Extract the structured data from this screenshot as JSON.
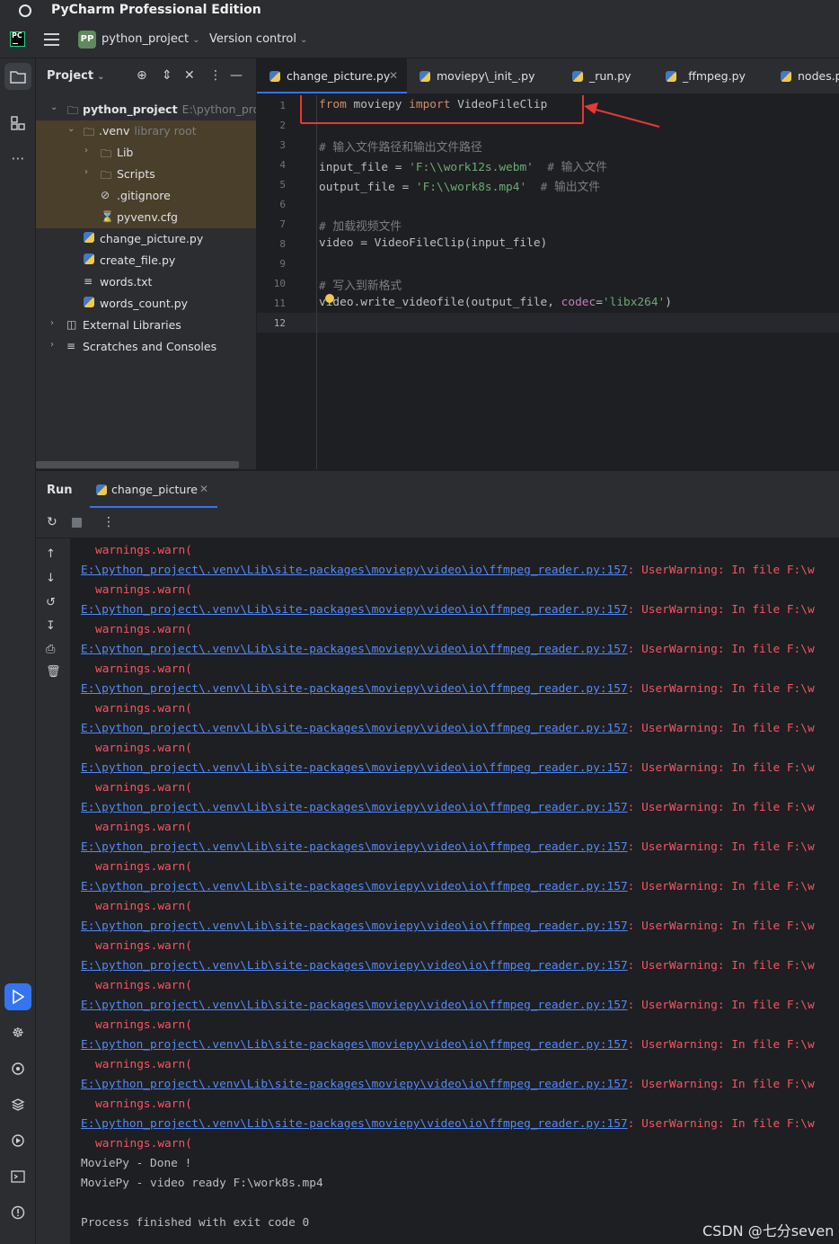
{
  "titlebar": {
    "title": "PyCharm Professional Edition"
  },
  "toolbar": {
    "project_badge": "PP",
    "project_name": "python_project",
    "vcs": "Version control"
  },
  "project_panel": {
    "title": "Project",
    "tree": [
      {
        "name": "python_project",
        "hint": "E:\\python_project"
      },
      {
        "name": ".venv",
        "hint": "library root"
      },
      {
        "name": "Lib"
      },
      {
        "name": "Scripts"
      },
      {
        "name": ".gitignore"
      },
      {
        "name": "pyvenv.cfg"
      },
      {
        "name": "change_picture.py"
      },
      {
        "name": "create_file.py"
      },
      {
        "name": "words.txt"
      },
      {
        "name": "words_count.py"
      },
      {
        "name": "External Libraries"
      },
      {
        "name": "Scratches and Consoles"
      }
    ]
  },
  "tabs": [
    {
      "label": "change_picture.py"
    },
    {
      "label": "moviepy\\_init_.py"
    },
    {
      "label": "_run.py"
    },
    {
      "label": "_ffmpeg.py"
    },
    {
      "label": "nodes.p"
    }
  ],
  "editor": {
    "line_numbers": [
      "1",
      "2",
      "3",
      "4",
      "5",
      "6",
      "7",
      "8",
      "9",
      "10",
      "11",
      "12"
    ],
    "code": {
      "l1_from": "from",
      "l1_mod": " moviepy ",
      "l1_import": "import",
      "l1_name": " VideoFileClip",
      "l3": "# 输入文件路径和输出文件路径",
      "l4_a": "input_file = ",
      "l4_s": "'F:\\\\work12s.webm'",
      "l4_c": "  # 输入文件",
      "l5_a": "output_file = ",
      "l5_s": "'F:\\\\work8s.mp4'",
      "l5_c": "  # 输出文件",
      "l7": "# 加载视频文件",
      "l8": "video = VideoFileClip(input_file)",
      "l10": "# 写入到新格式",
      "l11_a": "video.write_videofile(output_file, ",
      "l11_p": "codec",
      "l11_b": "=",
      "l11_s": "'libx264'",
      "l11_c": ")"
    }
  },
  "run_panel": {
    "label": "Run",
    "tab_label": "change_picture",
    "warn_call": "warnings.warn(",
    "warn_path": "E:\\python_project\\.venv\\Lib\\site-packages\\moviepy\\video\\io\\ffmpeg_reader.py:157",
    "warn_msg": ": UserWarning: In file F:\\w",
    "done": "MoviePy - Done !",
    "ready": "MoviePy - video ready F:\\work8s.mp4",
    "finished": "Process finished with exit code 0"
  },
  "watermark": "CSDN @七分seven"
}
